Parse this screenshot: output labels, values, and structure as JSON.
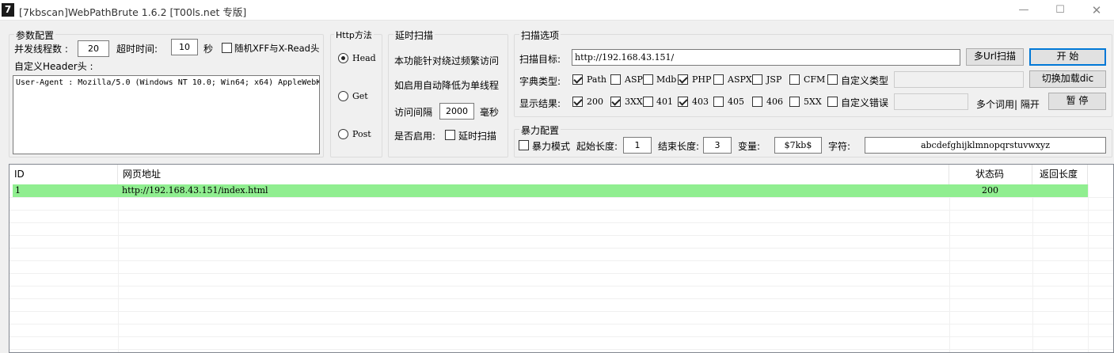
{
  "window": {
    "app_icon": "7",
    "title": "[7kbscan]WebPathBrute 1.6.2 [T00ls.net 专版]",
    "min_icon": "minimize-icon",
    "max_icon": "maximize-icon",
    "close_icon": "close-icon"
  },
  "params": {
    "legend": "参数配置",
    "threads_label": "并发线程数 :",
    "threads_value": "20",
    "timeout_label": "超时时间:",
    "timeout_value": "10",
    "timeout_unit": "秒",
    "random_xff_label": "随机XFF与X-Read头",
    "random_xff_checked": false,
    "header_label": "自定义Header头 :",
    "header_value": "User-Agent : Mozilla/5.0 (Windows NT 10.0; Win64; x64) AppleWebK"
  },
  "http": {
    "legend": "Http方法",
    "methods": [
      {
        "label": "Head",
        "selected": true
      },
      {
        "label": "Get",
        "selected": false
      },
      {
        "label": "Post",
        "selected": false
      }
    ]
  },
  "delay": {
    "legend": "延时扫描",
    "desc1": "本功能针对绕过频繁访问",
    "desc2": "如启用自动降低为单线程",
    "interval_label": "访问间隔",
    "interval_value": "2000",
    "interval_unit": "毫秒",
    "enable_label": "是否启用:",
    "enable_checkbox_label": "延时扫描",
    "enabled": false
  },
  "scan": {
    "legend": "扫描选项",
    "target_label": "扫描目标:",
    "target_value": "http://192.168.43.151/",
    "multi_url_button": "多Url扫描",
    "start_button": "开 始",
    "dict_label": "字典类型:",
    "dict_types": [
      {
        "label": "Path",
        "checked": true
      },
      {
        "label": "ASP",
        "checked": false
      },
      {
        "label": "Mdb",
        "checked": false
      },
      {
        "label": "PHP",
        "checked": true
      },
      {
        "label": "ASPX",
        "checked": false
      },
      {
        "label": "JSP",
        "checked": false
      },
      {
        "label": "CFM",
        "checked": false
      }
    ],
    "custom_type_label": "自定义类型",
    "custom_type_checked": false,
    "custom_type_value": "",
    "switch_dict_button": "切换加载dic",
    "result_label": "显示结果:",
    "result_codes": [
      {
        "label": "200",
        "checked": true
      },
      {
        "label": "3XX",
        "checked": true
      },
      {
        "label": "401",
        "checked": false
      },
      {
        "label": "403",
        "checked": true
      },
      {
        "label": "405",
        "checked": false
      },
      {
        "label": "406",
        "checked": false
      },
      {
        "label": "5XX",
        "checked": false
      }
    ],
    "custom_error_label": "自定义错误",
    "custom_error_checked": false,
    "custom_error_value": "",
    "multi_word_hint": "多个词用| 隔开",
    "pause_button": "暂 停"
  },
  "brute": {
    "legend": "暴力配置",
    "mode_label": "暴力模式",
    "mode_checked": false,
    "start_len_label": "起始长度:",
    "start_len_value": "1",
    "end_len_label": "结束长度:",
    "end_len_value": "3",
    "variable_label": "变量:",
    "variable_value": "$7kb$",
    "charset_label": "字符:",
    "charset_value": "abcdefghijklmnopqrstuvwxyz"
  },
  "results": {
    "columns": [
      "ID",
      "网页地址",
      "状态码",
      "返回长度"
    ],
    "rows": [
      {
        "id": "1",
        "url": "http://192.168.43.151/index.html",
        "status": "200",
        "length": "",
        "highlight": "#90ee90"
      }
    ]
  }
}
